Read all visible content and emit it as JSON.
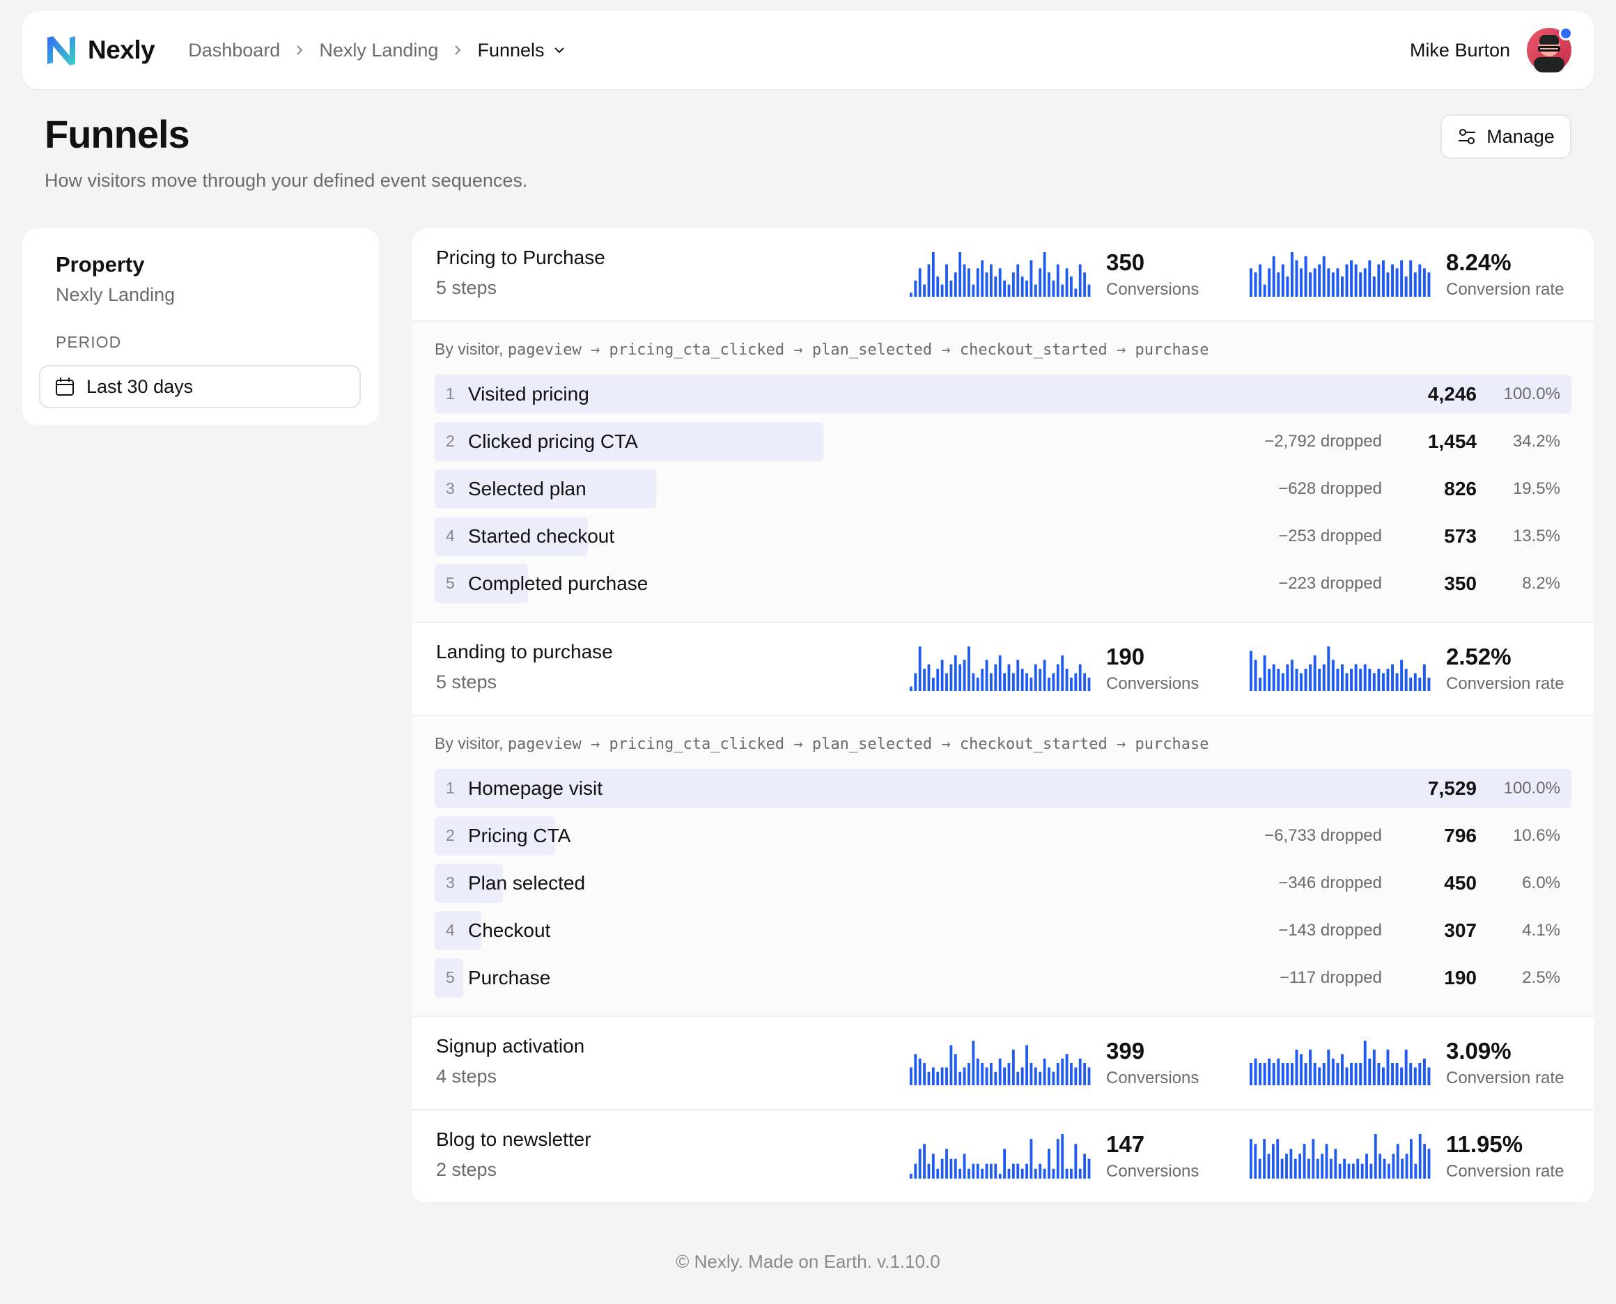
{
  "app": {
    "name": "Nexly"
  },
  "breadcrumb": [
    "Dashboard",
    "Nexly Landing",
    "Funnels"
  ],
  "user": {
    "name": "Mike Burton"
  },
  "page": {
    "title": "Funnels",
    "subtitle": "How visitors move through your defined event sequences.",
    "manage_label": "Manage"
  },
  "sidebar": {
    "property_label": "Property",
    "property_value": "Nexly Landing",
    "period_label": "PERIOD",
    "period_value": "Last 30 days"
  },
  "colors": {
    "accent": "#1f5af2",
    "bar_bg": "#ececfb"
  },
  "funnels": [
    {
      "name": "Pricing to Purchase",
      "steps_label": "5 steps",
      "conversions": "350",
      "conversions_label": "Conversions",
      "rate": "8.24%",
      "rate_label": "Conversion rate",
      "expanded": true,
      "path_prefix": "By visitor, ",
      "path": "pageview → pricing_cta_clicked → plan_selected → checkout_started → purchase",
      "spark_conv": [
        1,
        4,
        7,
        3,
        8,
        11,
        5,
        3,
        8,
        4,
        6,
        11,
        8,
        7,
        3,
        7,
        9,
        6,
        8,
        5,
        7,
        4,
        3,
        6,
        8,
        5,
        4,
        9,
        3,
        7,
        11,
        6,
        4,
        8,
        3,
        7,
        5,
        2,
        8,
        6,
        3
      ],
      "spark_rate": [
        7,
        6,
        8,
        3,
        7,
        10,
        6,
        8,
        5,
        11,
        9,
        7,
        10,
        6,
        7,
        8,
        10,
        7,
        6,
        7,
        5,
        8,
        9,
        8,
        6,
        7,
        9,
        5,
        8,
        9,
        6,
        8,
        7,
        9,
        5,
        9,
        6,
        8,
        7,
        6
      ],
      "steps": [
        {
          "n": "1",
          "label": "Visited pricing",
          "dropped": "",
          "value": "4,246",
          "pct": "100.0%",
          "ratio": 1.0
        },
        {
          "n": "2",
          "label": "Clicked pricing CTA",
          "dropped": "−2,792 dropped",
          "value": "1,454",
          "pct": "34.2%",
          "ratio": 0.342
        },
        {
          "n": "3",
          "label": "Selected plan",
          "dropped": "−628 dropped",
          "value": "826",
          "pct": "19.5%",
          "ratio": 0.195
        },
        {
          "n": "4",
          "label": "Started checkout",
          "dropped": "−253 dropped",
          "value": "573",
          "pct": "13.5%",
          "ratio": 0.135
        },
        {
          "n": "5",
          "label": "Completed purchase",
          "dropped": "−223 dropped",
          "value": "350",
          "pct": "8.2%",
          "ratio": 0.082
        }
      ]
    },
    {
      "name": "Landing to purchase",
      "steps_label": "5 steps",
      "conversions": "190",
      "conversions_label": "Conversions",
      "rate": "2.52%",
      "rate_label": "Conversion rate",
      "expanded": true,
      "path_prefix": "By visitor, ",
      "path": "pageview → pricing_cta_clicked → plan_selected → checkout_started → purchase",
      "spark_conv": [
        1,
        4,
        10,
        5,
        6,
        3,
        5,
        7,
        4,
        6,
        8,
        6,
        7,
        10,
        4,
        3,
        5,
        7,
        4,
        6,
        8,
        4,
        6,
        4,
        7,
        5,
        4,
        3,
        6,
        5,
        7,
        3,
        4,
        6,
        8,
        5,
        3,
        4,
        6,
        4,
        3
      ],
      "spark_rate": [
        9,
        7,
        3,
        8,
        5,
        6,
        5,
        4,
        6,
        7,
        5,
        4,
        5,
        6,
        8,
        5,
        6,
        10,
        7,
        5,
        6,
        4,
        5,
        6,
        5,
        6,
        5,
        4,
        5,
        4,
        5,
        6,
        4,
        7,
        5,
        3,
        4,
        3,
        6,
        3
      ],
      "steps": [
        {
          "n": "1",
          "label": "Homepage visit",
          "dropped": "",
          "value": "7,529",
          "pct": "100.0%",
          "ratio": 1.0
        },
        {
          "n": "2",
          "label": "Pricing CTA",
          "dropped": "−6,733 dropped",
          "value": "796",
          "pct": "10.6%",
          "ratio": 0.106
        },
        {
          "n": "3",
          "label": "Plan selected",
          "dropped": "−346 dropped",
          "value": "450",
          "pct": "6.0%",
          "ratio": 0.06
        },
        {
          "n": "4",
          "label": "Checkout",
          "dropped": "−143 dropped",
          "value": "307",
          "pct": "4.1%",
          "ratio": 0.041
        },
        {
          "n": "5",
          "label": "Purchase",
          "dropped": "−117 dropped",
          "value": "190",
          "pct": "2.5%",
          "ratio": 0.025
        }
      ]
    },
    {
      "name": "Signup activation",
      "steps_label": "4 steps",
      "conversions": "399",
      "conversions_label": "Conversions",
      "rate": "3.09%",
      "rate_label": "Conversion rate",
      "expanded": false,
      "spark_conv": [
        4,
        7,
        6,
        5,
        3,
        4,
        3,
        4,
        4,
        9,
        7,
        3,
        4,
        5,
        10,
        6,
        5,
        4,
        5,
        3,
        6,
        4,
        5,
        8,
        3,
        4,
        9,
        5,
        4,
        3,
        6,
        4,
        3,
        5,
        6,
        7,
        5,
        4,
        6,
        5,
        4
      ],
      "spark_rate": [
        5,
        6,
        5,
        5,
        6,
        5,
        6,
        5,
        5,
        5,
        8,
        7,
        5,
        8,
        5,
        4,
        5,
        8,
        6,
        5,
        7,
        4,
        5,
        5,
        5,
        10,
        6,
        8,
        5,
        4,
        8,
        5,
        5,
        4,
        8,
        5,
        4,
        5,
        6,
        4
      ],
      "steps": []
    },
    {
      "name": "Blog to newsletter",
      "steps_label": "2 steps",
      "conversions": "147",
      "conversions_label": "Conversions",
      "rate": "11.95%",
      "rate_label": "Conversion rate",
      "expanded": false,
      "spark_conv": [
        1,
        3,
        6,
        7,
        3,
        5,
        2,
        4,
        6,
        4,
        4,
        2,
        5,
        2,
        3,
        3,
        2,
        3,
        3,
        3,
        1,
        6,
        2,
        3,
        3,
        2,
        3,
        8,
        2,
        3,
        2,
        6,
        2,
        8,
        9,
        2,
        2,
        7,
        2,
        5,
        4
      ],
      "spark_rate": [
        8,
        7,
        4,
        8,
        5,
        7,
        8,
        4,
        5,
        6,
        4,
        5,
        7,
        4,
        8,
        4,
        5,
        7,
        4,
        6,
        3,
        4,
        3,
        3,
        4,
        3,
        5,
        3,
        9,
        5,
        4,
        3,
        5,
        7,
        4,
        5,
        8,
        3,
        9,
        7,
        6
      ],
      "steps": []
    }
  ],
  "footer": "© Nexly. Made on Earth. v.1.10.0"
}
